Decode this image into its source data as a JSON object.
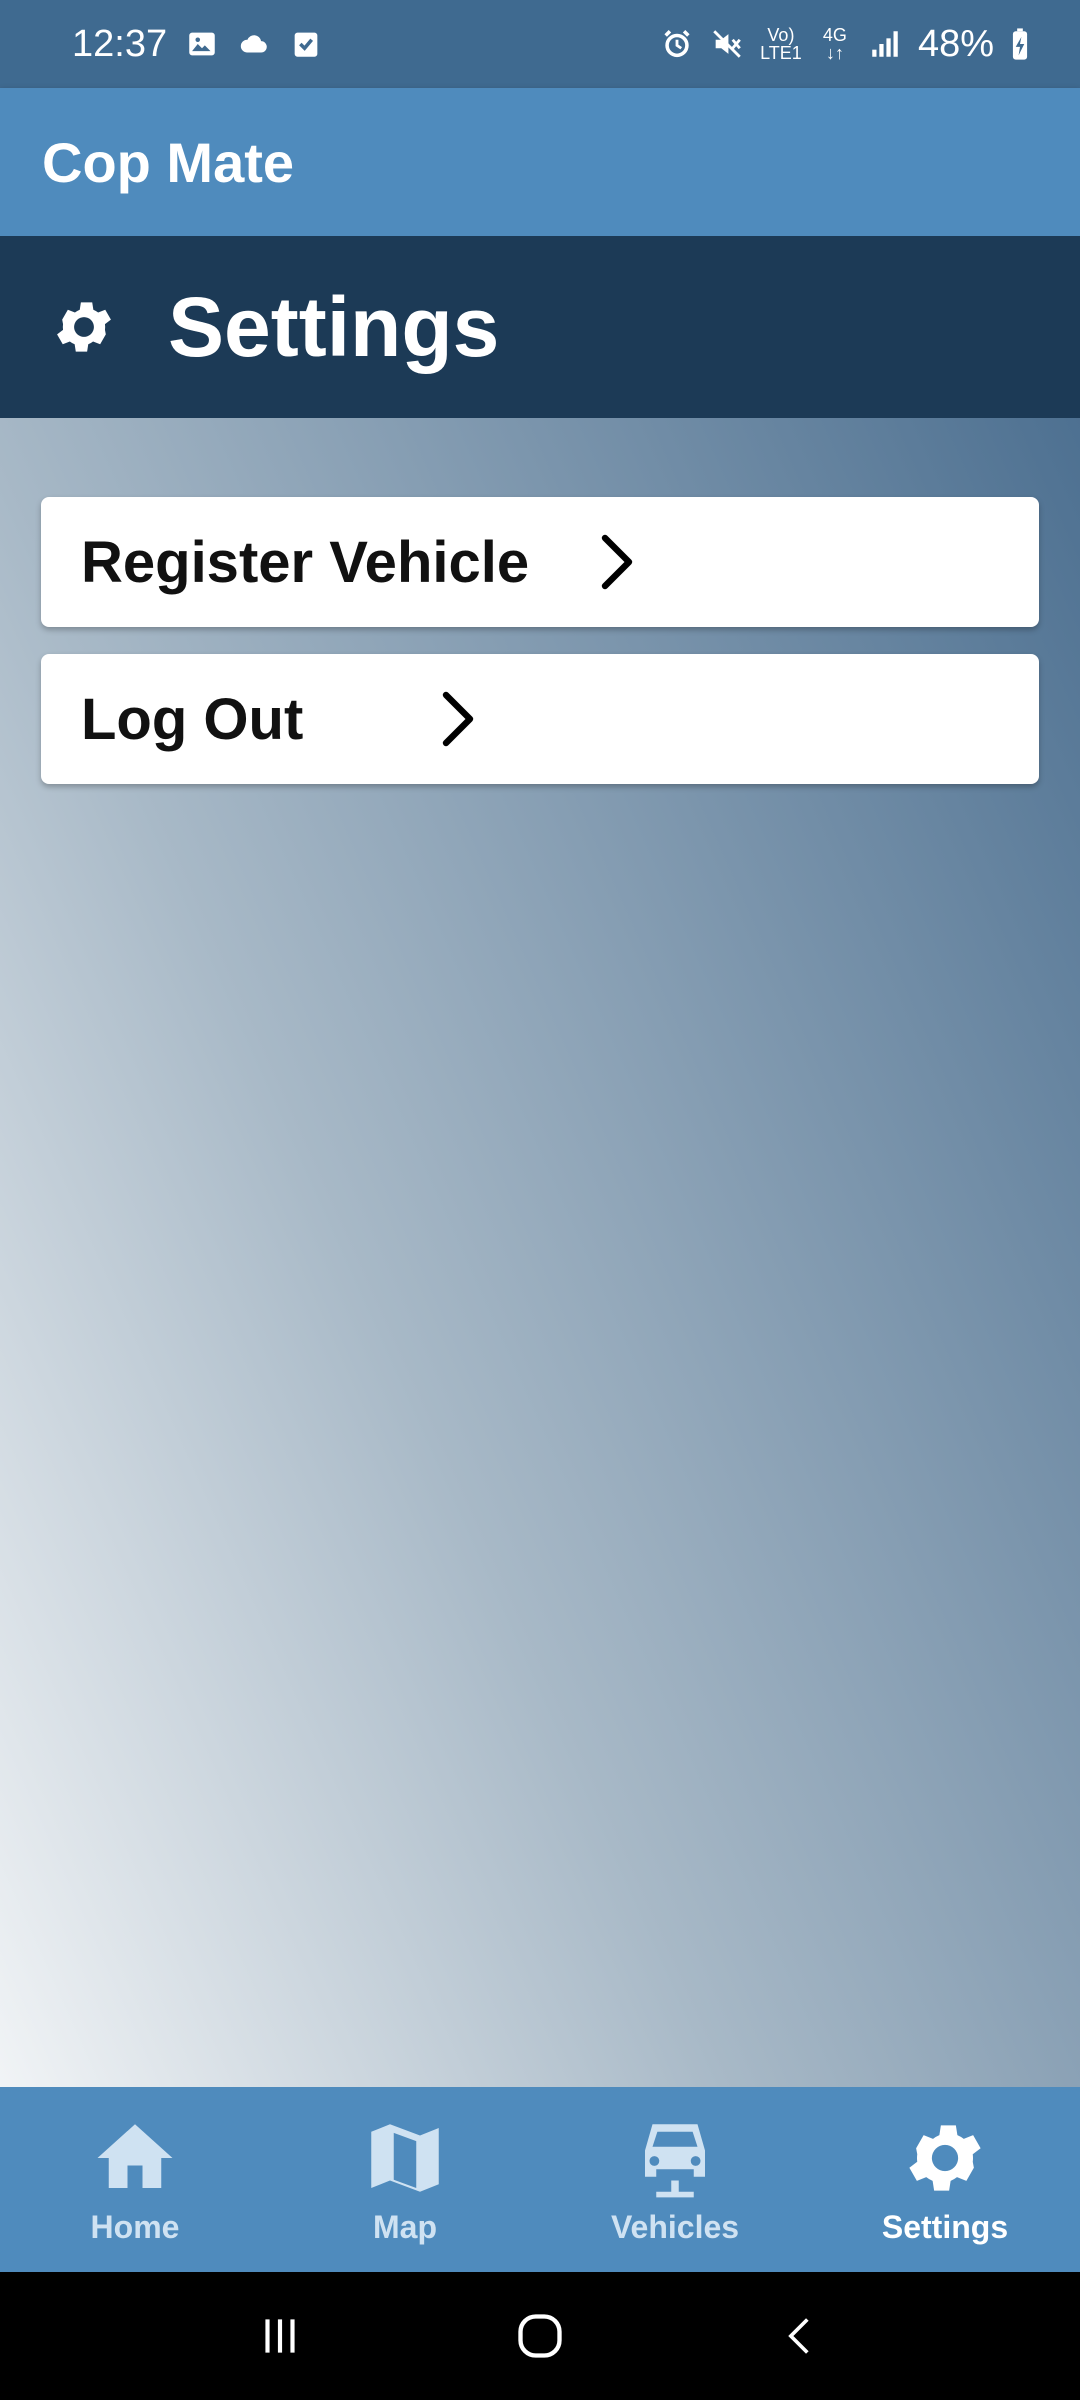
{
  "status_bar": {
    "time": "12:37",
    "network_top": "Vo)",
    "network_bottom": "LTE1",
    "data_type": "4G",
    "battery": "48%"
  },
  "app": {
    "title": "Cop Mate"
  },
  "page": {
    "title": "Settings",
    "icon": "gear-icon"
  },
  "menu": {
    "items": [
      {
        "label": "Register Vehicle"
      },
      {
        "label": "Log Out"
      }
    ]
  },
  "bottom_nav": {
    "items": [
      {
        "label": "Home",
        "icon": "home-icon"
      },
      {
        "label": "Map",
        "icon": "map-icon"
      },
      {
        "label": "Vehicles",
        "icon": "car-icon"
      },
      {
        "label": "Settings",
        "icon": "gear-icon"
      }
    ],
    "active": "Settings"
  },
  "colors": {
    "status_bar": "#3f6a90",
    "app_bar": "#4f8bbd",
    "section_header": "#1c3a56",
    "nav_inactive": "#cfe2f2",
    "nav_active": "#ffffff"
  }
}
